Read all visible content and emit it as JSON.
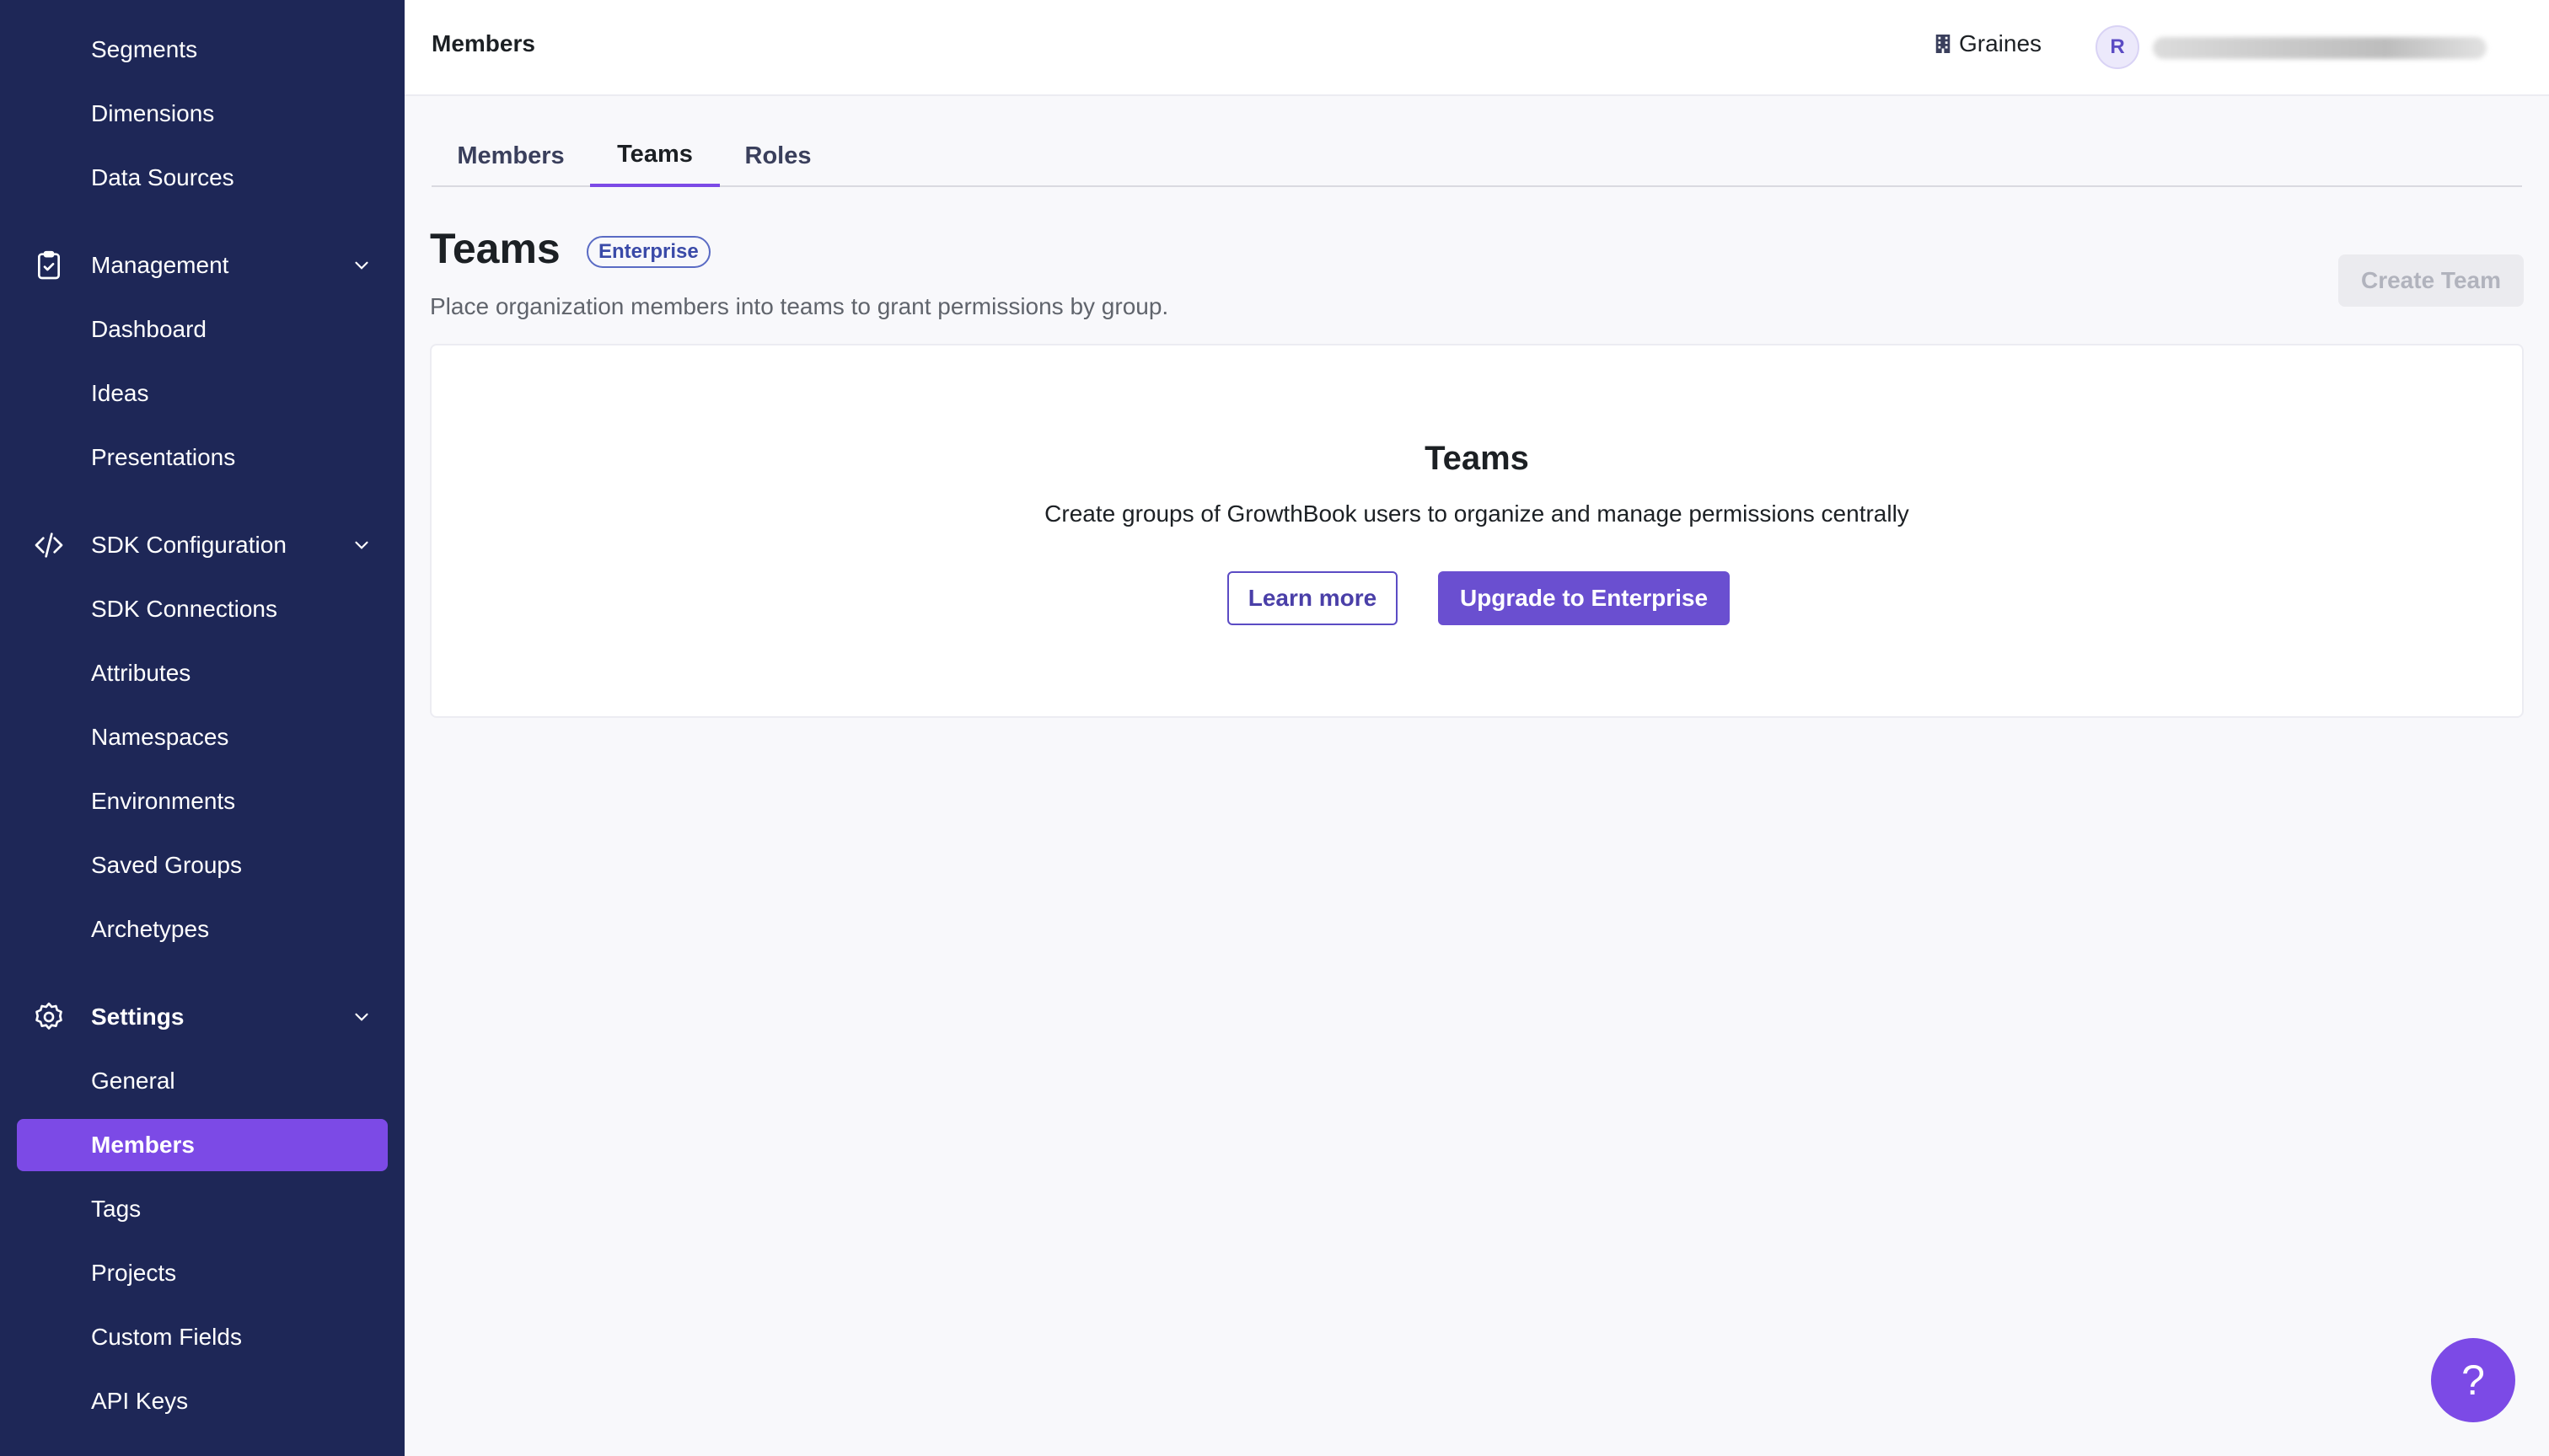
{
  "sidebar": {
    "items_top": [
      {
        "label": "Segments"
      },
      {
        "label": "Dimensions"
      },
      {
        "label": "Data Sources"
      }
    ],
    "management": {
      "label": "Management",
      "icon": "clipboard-check-icon",
      "items": [
        {
          "label": "Dashboard"
        },
        {
          "label": "Ideas"
        },
        {
          "label": "Presentations"
        }
      ]
    },
    "sdk": {
      "label": "SDK Configuration",
      "icon": "code-icon",
      "items": [
        {
          "label": "SDK Connections"
        },
        {
          "label": "Attributes"
        },
        {
          "label": "Namespaces"
        },
        {
          "label": "Environments"
        },
        {
          "label": "Saved Groups"
        },
        {
          "label": "Archetypes"
        }
      ]
    },
    "settings": {
      "label": "Settings",
      "icon": "gear-icon",
      "items": [
        {
          "label": "General"
        },
        {
          "label": "Members",
          "active": true
        },
        {
          "label": "Tags"
        },
        {
          "label": "Projects"
        },
        {
          "label": "Custom Fields"
        },
        {
          "label": "API Keys"
        }
      ]
    }
  },
  "header": {
    "title": "Members",
    "org_name": "Graines",
    "avatar_initial": "R"
  },
  "tabs": [
    {
      "label": "Members"
    },
    {
      "label": "Teams",
      "active": true
    },
    {
      "label": "Roles"
    }
  ],
  "page": {
    "title": "Teams",
    "badge": "Enterprise",
    "description": "Place organization members into teams to grant permissions by group.",
    "create_button": "Create Team"
  },
  "card": {
    "title": "Teams",
    "description": "Create groups of GrowthBook users to organize and manage permissions centrally",
    "learn_more": "Learn more",
    "upgrade": "Upgrade to Enterprise"
  },
  "help": {
    "label": "?"
  },
  "colors": {
    "sidebar_bg": "#1e2757",
    "accent": "#7c4ae6",
    "upgrade_bg": "#6a4fd0"
  }
}
